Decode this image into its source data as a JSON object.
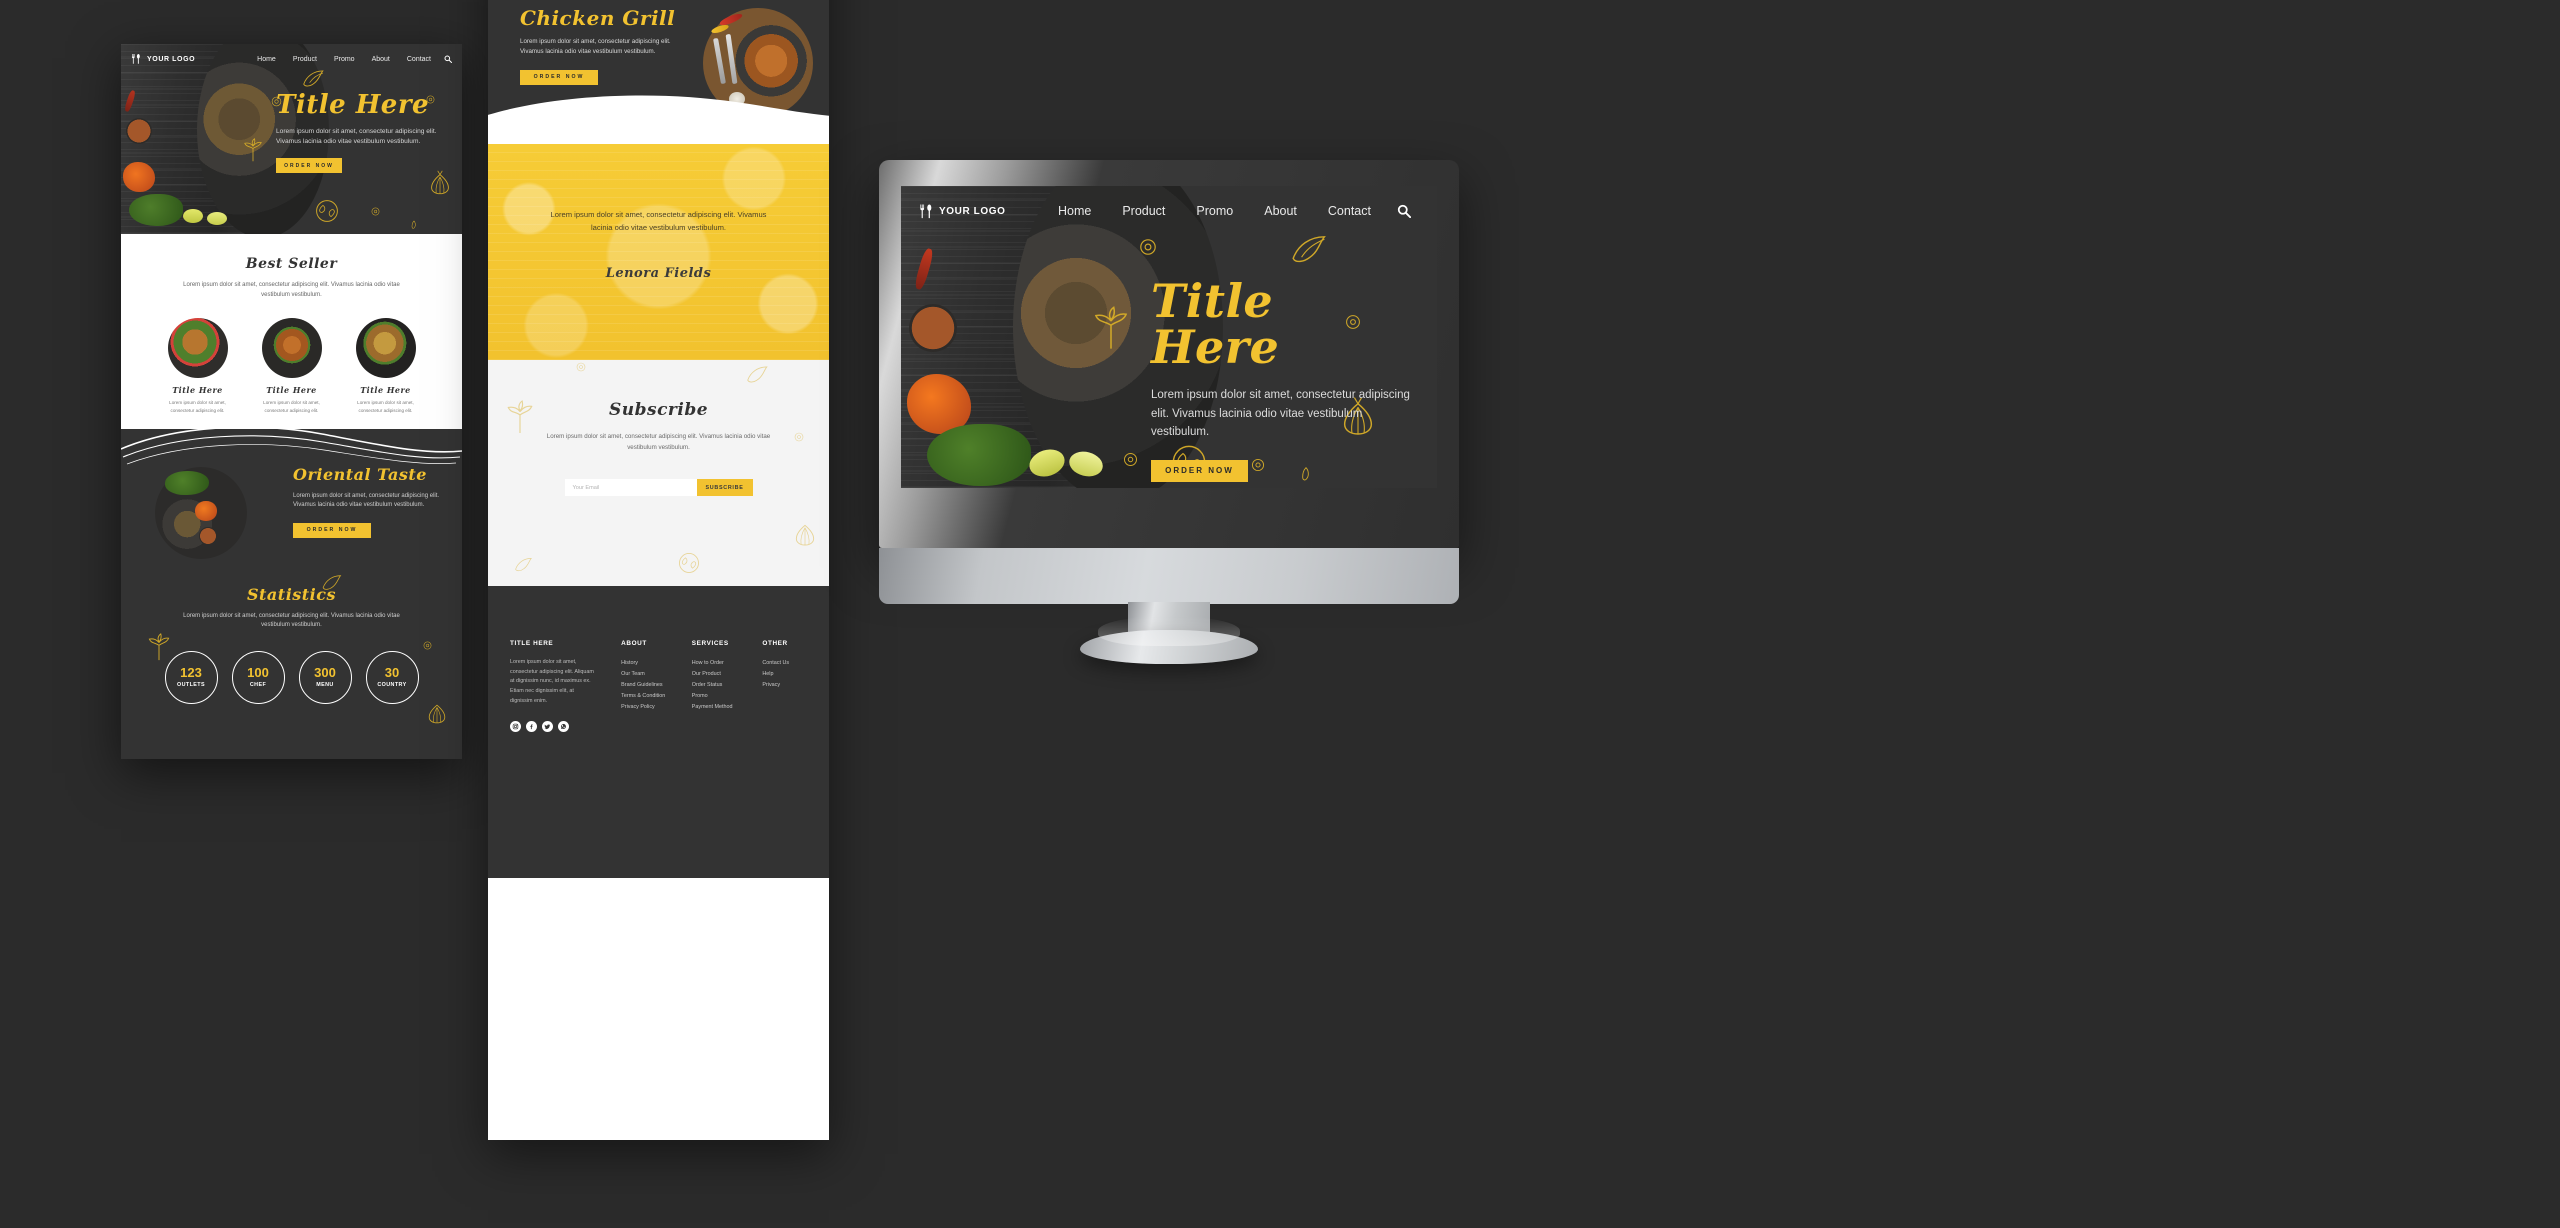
{
  "brand": {
    "logo_text": "YOUR LOGO",
    "accent_color": "#f2c230",
    "dark_color": "#333333",
    "logo_icon": "fork-spoon-icon"
  },
  "nav": {
    "items": [
      "Home",
      "Product",
      "Promo",
      "About",
      "Contact"
    ],
    "search_icon": "search-icon"
  },
  "hero": {
    "title": "Title Here",
    "body": "Lorem ipsum dolor sit amet, consectetur adipiscing elit. Vivamus lacinia odio vitae vestibulum vestibulum.",
    "cta": "ORDER NOW"
  },
  "best_seller": {
    "title": "Best Seller",
    "body": "Lorem ipsum dolor sit amet, consectetur adipiscing elit. Vivamus lacinia odio vitae vestibulum vestibulum.",
    "cards": [
      {
        "title": "Title Here",
        "body": "Lorem ipsum dolor sit amet, consectetur adipiscing elit."
      },
      {
        "title": "Title Here",
        "body": "Lorem ipsum dolor sit amet, consectetur adipiscing elit."
      },
      {
        "title": "Title Here",
        "body": "Lorem ipsum dolor sit amet, consectetur adipiscing elit."
      }
    ]
  },
  "oriental": {
    "title": "Oriental Taste",
    "body": "Lorem ipsum dolor sit amet, consectetur adipiscing elit. Vivamus lacinia odio vitae vestibulum vestibulum.",
    "cta": "ORDER NOW"
  },
  "statistics": {
    "title": "Statistics",
    "body": "Lorem ipsum dolor sit amet, consectetur adipiscing elit. Vivamus lacinia odio vitae vestibulum vestibulum.",
    "items": [
      {
        "number": "123",
        "label": "OUTLETS"
      },
      {
        "number": "100",
        "label": "CHEF"
      },
      {
        "number": "300",
        "label": "MENU"
      },
      {
        "number": "30",
        "label": "COUNTRY"
      }
    ]
  },
  "chicken_grill": {
    "title": "Chicken Grill",
    "body": "Lorem ipsum dolor sit amet, consectetur adipiscing elit. Vivamus lacinia odio vitae vestibulum vestibulum.",
    "cta": "ORDER NOW"
  },
  "testimonial": {
    "quote": "Lorem ipsum dolor sit amet, consectetur adipiscing elit. Vivamus lacinia odio vitae vestibulum vestibulum.",
    "author": "Lenora Fields"
  },
  "subscribe": {
    "title": "Subscribe",
    "body": "Lorem ipsum dolor sit amet, consectetur adipiscing elit. Vivamus lacinia odio vitae vestibulum vestibulum.",
    "placeholder": "Your Email",
    "value": "",
    "button": "SUBSCRIBE"
  },
  "footer": {
    "brand_title": "TITLE HERE",
    "brand_body": "Lorem ipsum dolor sit amet, consectetur adipiscing elit. Aliquam at dignissim nunc, id maximus ex. Etiam nec dignissim elit, at dignissim enim.",
    "socials": [
      "instagram-icon",
      "facebook-icon",
      "twitter-icon",
      "whatsapp-icon"
    ],
    "columns": [
      {
        "heading": "ABOUT",
        "links": [
          "History",
          "Our Team",
          "Brand Guidelines",
          "Terms & Condition",
          "Privacy Policy"
        ]
      },
      {
        "heading": "SERVICES",
        "links": [
          "How to Order",
          "Our Product",
          "Order Status",
          "Promo",
          "Payment Method"
        ]
      },
      {
        "heading": "OTHER",
        "links": [
          "Contact Us",
          "Help",
          "Privacy"
        ]
      }
    ]
  }
}
